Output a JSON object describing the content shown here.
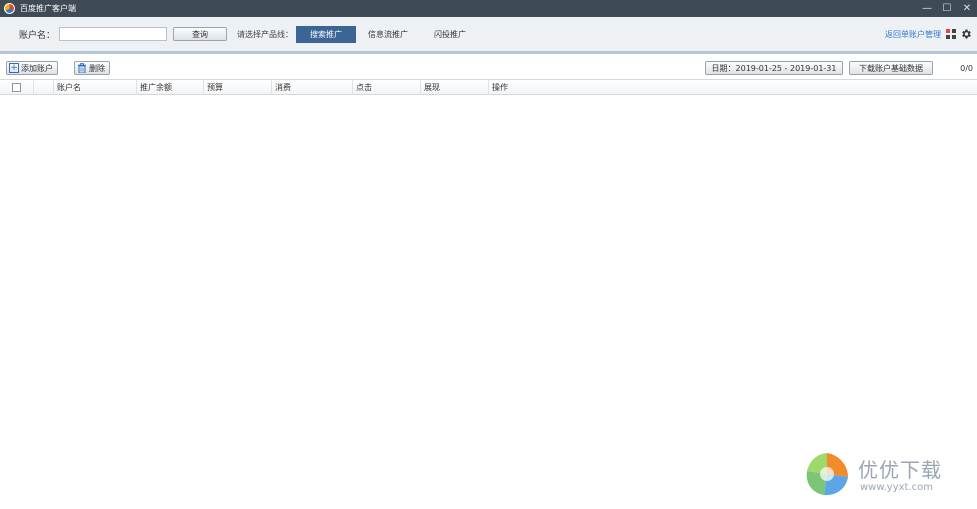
{
  "window": {
    "title": "百度推广客户端",
    "minimize": "—",
    "maximize": "☐",
    "close": "✕"
  },
  "toolbar": {
    "account_label": "账户名：",
    "account_input_value": "",
    "query_button": "查询",
    "product_line_label": "请选择产品线：",
    "tabs": [
      {
        "label": "搜索推广",
        "active": true
      },
      {
        "label": "信息流推广",
        "active": false
      },
      {
        "label": "闪投推广",
        "active": false
      }
    ],
    "back_link": "返回单账户管理"
  },
  "actions": {
    "add_account": "添加账户",
    "delete": "删除",
    "date_range": "日期：2019-01-25 - 2019-01-31",
    "download": "下载账户基础数据",
    "count": "0/0"
  },
  "table": {
    "columns": [
      "账户名",
      "推广余额",
      "预算",
      "消费",
      "点击",
      "展现",
      "操作"
    ],
    "rows": []
  },
  "watermark": {
    "text": "优优下载",
    "url": "www.yyxt.com"
  },
  "colors": {
    "titlebar": "#3f4a57",
    "active_tab": "#3a6594",
    "link": "#2e7bcf"
  }
}
